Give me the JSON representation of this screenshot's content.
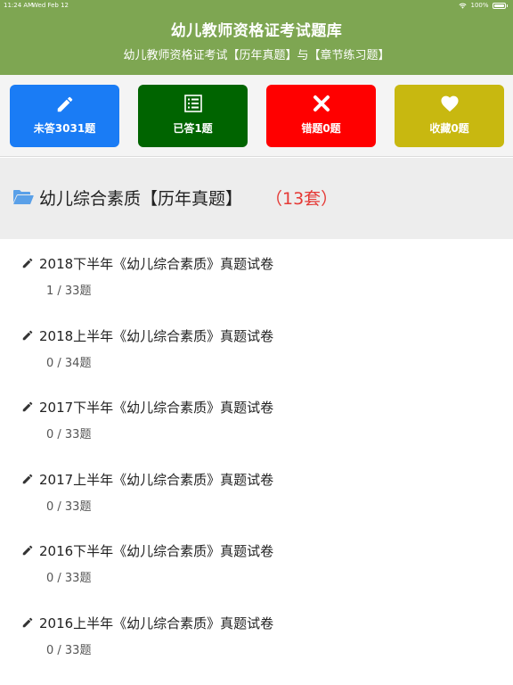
{
  "status_bar": {
    "time": "11:24 AM",
    "date": "Wed Feb 12",
    "battery": "100%"
  },
  "header": {
    "title": "幼儿教师资格证考试题库",
    "subtitle": "幼儿教师资格证考试【历年真题】与【章节练习题】"
  },
  "stats": [
    {
      "label": "未答3031题",
      "icon": "pencil-icon",
      "color": "#1a7cf5"
    },
    {
      "label": "已答1题",
      "icon": "list-icon",
      "color": "#006400"
    },
    {
      "label": "错题0题",
      "icon": "close-icon",
      "color": "#ff0000"
    },
    {
      "label": "收藏0题",
      "icon": "heart-icon",
      "color": "#c8b810"
    }
  ],
  "section": {
    "title": "幼儿综合素质【历年真题】",
    "count": "（13套）",
    "icon": "folder-open-icon"
  },
  "exams": [
    {
      "title": "2018下半年《幼儿综合素质》真题试卷",
      "progress": "1 / 33题"
    },
    {
      "title": "2018上半年《幼儿综合素质》真题试卷",
      "progress": "0 / 34题"
    },
    {
      "title": "2017下半年《幼儿综合素质》真题试卷",
      "progress": "0 / 33题"
    },
    {
      "title": "2017上半年《幼儿综合素质》真题试卷",
      "progress": "0 / 33题"
    },
    {
      "title": "2016下半年《幼儿综合素质》真题试卷",
      "progress": "0 / 33题"
    },
    {
      "title": "2016上半年《幼儿综合素质》真题试卷",
      "progress": "0 / 33题"
    }
  ]
}
